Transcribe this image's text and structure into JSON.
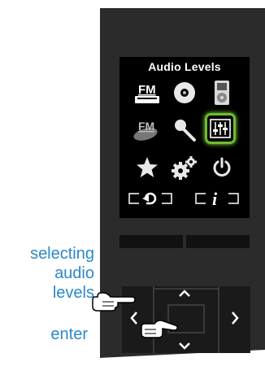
{
  "screen": {
    "title": "Audio Levels",
    "icons": [
      {
        "name": "fm-radio-icon",
        "selected": false
      },
      {
        "name": "cd-icon",
        "selected": false
      },
      {
        "name": "ipod-icon",
        "selected": false
      },
      {
        "name": "fm-presets-icon",
        "selected": false
      },
      {
        "name": "microphone-icon",
        "selected": false
      },
      {
        "name": "audio-levels-icon",
        "selected": true
      },
      {
        "name": "star-icon",
        "selected": false
      },
      {
        "name": "settings-icon",
        "selected": false
      },
      {
        "name": "power-icon",
        "selected": false
      }
    ],
    "softkey_left_icon": "back-icon",
    "softkey_right_icon": "info-icon",
    "softkey_right_glyph": "i"
  },
  "annotations": {
    "selecting": "selecting",
    "audio": "audio",
    "levels": "levels",
    "enter": "enter"
  },
  "dpad": {
    "up": "^",
    "down": "v",
    "left": "<",
    "right": ">"
  },
  "colors": {
    "body": "#2a2a2a",
    "screen": "#000000",
    "highlight": "#6dbe2e",
    "label": "#2b88c8"
  }
}
